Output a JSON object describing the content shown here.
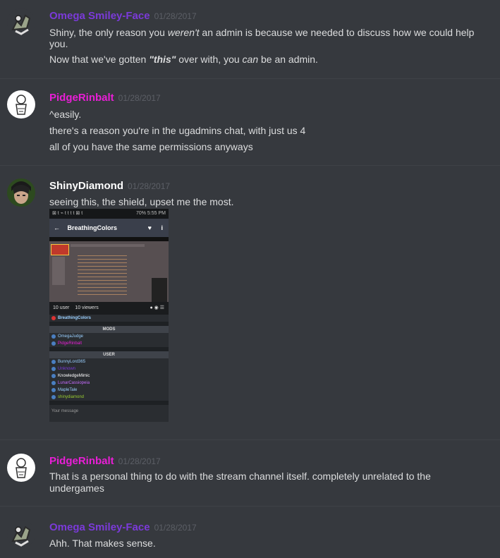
{
  "messages": [
    {
      "user": "Omega Smiley-Face",
      "user_color": "#7b3ad9",
      "time": "01/28/2017",
      "lines": [
        [
          "Shiny, the only reason you ",
          "weren't",
          " an admin is because we needed to discuss how we could help"
        ],
        [
          "you."
        ],
        [
          "Now that we've gotten ",
          "\"this\"",
          " over with, you ",
          "can",
          " be an admin."
        ]
      ]
    },
    {
      "user": "PidgeRinbalt",
      "user_color": "#e91ed6",
      "time": "01/28/2017",
      "lines": [
        "^easily.",
        "there's a reason you're in the ugadmins chat, with just us 4",
        "all of you have the same permissions anyways"
      ]
    },
    {
      "user": "ShinyDiamond",
      "user_color": "#ffffff",
      "time": "01/28/2017",
      "lines": [
        "seeing this, the shield, upset me the most."
      ]
    },
    {
      "user": "PidgeRinbalt",
      "user_color": "#e91ed6",
      "time": "01/28/2017",
      "lines": [
        "That is a personal thing to do with the stream channel itself. completely unrelated to the",
        "undergames"
      ]
    },
    {
      "user": "Omega Smiley-Face",
      "user_color": "#7b3ad9",
      "time": "01/28/2017",
      "lines": [
        "Ahh. That makes sense."
      ]
    }
  ],
  "screenshot": {
    "status_right": "70% 5:55 PM",
    "channel": "BreathingColors",
    "viewer_count": "10 user",
    "viewers_label": "10 viewers",
    "host": "BreathingColors",
    "mods_label": "MODS",
    "mods": [
      "OmegaJudge",
      "PidgeRinbalt"
    ],
    "user_label": "USER",
    "users": [
      "BunnyLord365",
      "Unknown",
      "KnowledgeMimic",
      "LunarCassiopeia",
      "MapleTale",
      "shinydiamond"
    ],
    "user_colors": [
      "#9ad0ff",
      "#7b3ad9",
      "#ffffff",
      "#c66cff",
      "#9ad0ff",
      "#9acd32"
    ],
    "mod_colors": [
      "#9ad0ff",
      "#e91ed6"
    ],
    "message_placeholder": "Your message"
  }
}
